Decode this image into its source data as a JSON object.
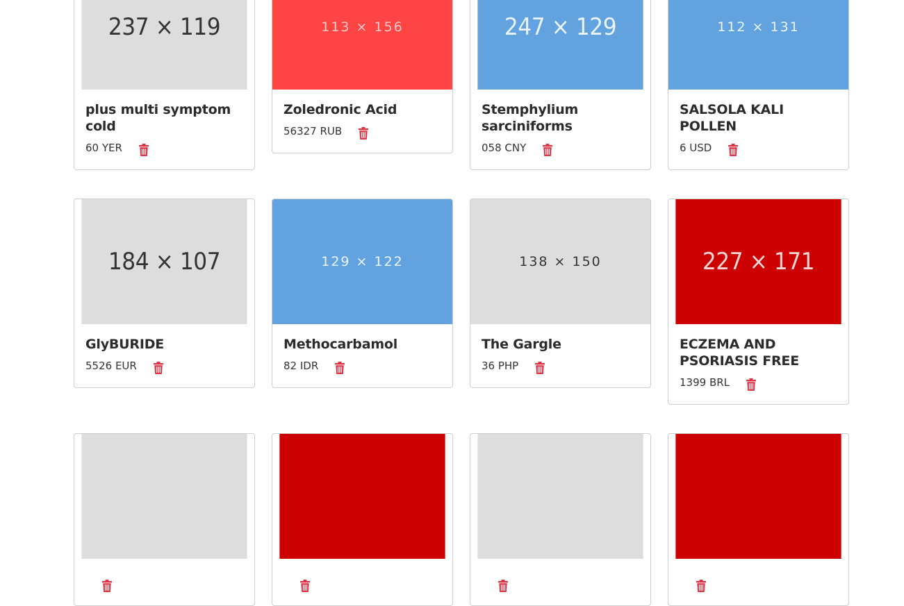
{
  "colors": {
    "gray": "#dddddd",
    "gray_text": "#333333",
    "blue": "#62a3df",
    "blue_text": "#eaf4ff",
    "salmon": "#ff4444",
    "salmon_text": "#ffc9c9",
    "red": "#cc0000",
    "red_text": "#ffd6d6",
    "trash": "#dc3545"
  },
  "products": [
    {
      "thumb": "237 x 119",
      "thumb_color": "gray",
      "thumb_style": "big",
      "name": "plus multi symptom cold",
      "price": "60 YER"
    },
    {
      "thumb": "113 x 156",
      "thumb_color": "salmon",
      "thumb_style": "small",
      "name": "Zoledronic Acid",
      "price": "56327 RUB"
    },
    {
      "thumb": "247 x 129",
      "thumb_color": "blue",
      "thumb_style": "big",
      "name": "Stemphylium sarciniforms",
      "price": "058 CNY"
    },
    {
      "thumb": "112 x 131",
      "thumb_color": "blue",
      "thumb_style": "small",
      "name": "SALSOLA KALI POLLEN",
      "price": "6 USD"
    },
    {
      "thumb": "184 x 107",
      "thumb_color": "gray",
      "thumb_style": "big",
      "name": "GlyBURIDE",
      "price": "5526 EUR"
    },
    {
      "thumb": "129 x 122",
      "thumb_color": "blue",
      "thumb_style": "small",
      "name": "Methocarbamol",
      "price": "82 IDR"
    },
    {
      "thumb": "138 x 150",
      "thumb_color": "gray",
      "thumb_style": "small",
      "name": "The Gargle",
      "price": "36 PHP"
    },
    {
      "thumb": "227 x 171",
      "thumb_color": "red",
      "thumb_style": "big",
      "name": "ECZEMA AND PSORIASIS FREE",
      "price": "1399 BRL"
    },
    {
      "thumb": "",
      "thumb_color": "gray",
      "thumb_style": "big",
      "name": "",
      "price": ""
    },
    {
      "thumb": "",
      "thumb_color": "red",
      "thumb_style": "big",
      "name": "",
      "price": ""
    },
    {
      "thumb": "",
      "thumb_color": "gray",
      "thumb_style": "big",
      "name": "",
      "price": ""
    },
    {
      "thumb": "",
      "thumb_color": "red",
      "thumb_style": "big",
      "name": "",
      "price": ""
    }
  ],
  "icons": {
    "delete": "trash-icon"
  }
}
